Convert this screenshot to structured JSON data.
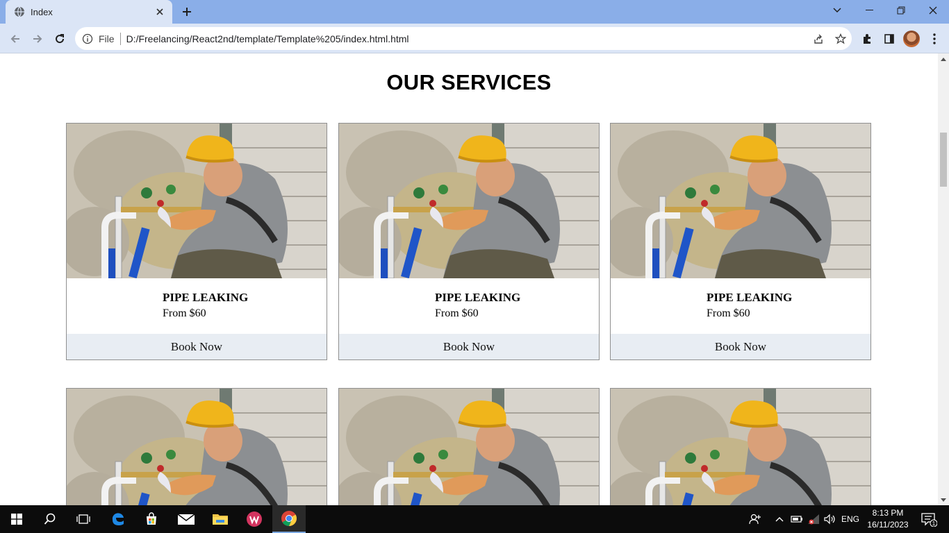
{
  "browser": {
    "tab_title": "Index",
    "address_scheme_label": "File",
    "address_url": "D:/Freelancing/React2nd/template/Template%205/index.html.html"
  },
  "page": {
    "heading": "OUR SERVICES",
    "cards": [
      {
        "name": "PIPE LEAKING",
        "price": "From $60",
        "button": "Book Now"
      },
      {
        "name": "PIPE LEAKING",
        "price": "From $60",
        "button": "Book Now"
      },
      {
        "name": "PIPE LEAKING",
        "price": "From $60",
        "button": "Book Now"
      }
    ]
  },
  "taskbar": {
    "language": "ENG",
    "time": "8:13 PM",
    "date": "16/11/2023",
    "notification_count": "1"
  },
  "colors": {
    "tabstrip": "#8aaee8",
    "toolbar": "#dbe5f6",
    "book_button_bg": "#e8edf3",
    "taskbar": "#0c0c0c"
  }
}
